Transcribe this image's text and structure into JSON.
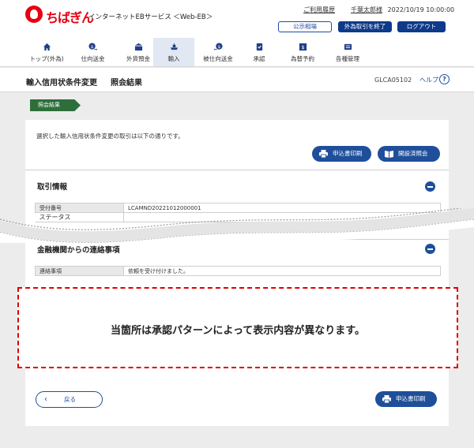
{
  "header": {
    "brand": "ちばぎん",
    "service_name": "インターネットEBサービス ＜Web-EB＞",
    "history_link": "ご利用履歴",
    "user_name": "千葉太郎様",
    "datetime": "2022/10/19 10:00:00",
    "public_rates_button": "公示相場",
    "fx_logout_button": "外為取引を終了",
    "logout_button": "ログアウト",
    "brand_color": "#e60012"
  },
  "nav": {
    "items": [
      {
        "label": "トップ(外為)",
        "icon": "home-icon"
      },
      {
        "label": "仕向送金",
        "icon": "outgoing-remittance-icon"
      },
      {
        "label": "外貨預金",
        "icon": "foreign-deposit-icon"
      },
      {
        "label": "輸入",
        "icon": "import-ship-icon"
      },
      {
        "label": "被仕向送金",
        "icon": "incoming-remittance-icon"
      },
      {
        "label": "承認",
        "icon": "approval-icon"
      },
      {
        "label": "為替予約",
        "icon": "fx-contract-icon"
      },
      {
        "label": "各種管理",
        "icon": "management-icon"
      }
    ],
    "active_index": 3
  },
  "title": {
    "main": "輸入信用状条件変更",
    "sub": "照会結果",
    "screen_id": "GLCA05102",
    "help": "ヘルプ",
    "help_mark": "?"
  },
  "step": {
    "label": "照会結果"
  },
  "panel": {
    "message": "選択した輸入信用状条件変更の取引は以下の通りです。",
    "print_button": "申込書印刷",
    "history_button": "開設済照会",
    "transaction_section": {
      "title": "取引情報",
      "rows": [
        {
          "label": "受付番号",
          "value": "LCAMND20221012000001"
        },
        {
          "label": "ステータス",
          "value": ""
        }
      ]
    },
    "bank_section": {
      "title": "金融機関からの連絡事項",
      "rows": [
        {
          "label": "連絡事項",
          "value": "依頼を受け付けました。"
        }
      ]
    },
    "back_button": "戻る",
    "print_button_bottom": "申込書印刷"
  },
  "notice": {
    "text": "当箇所は承認パターンによって表示内容が異なります。"
  }
}
